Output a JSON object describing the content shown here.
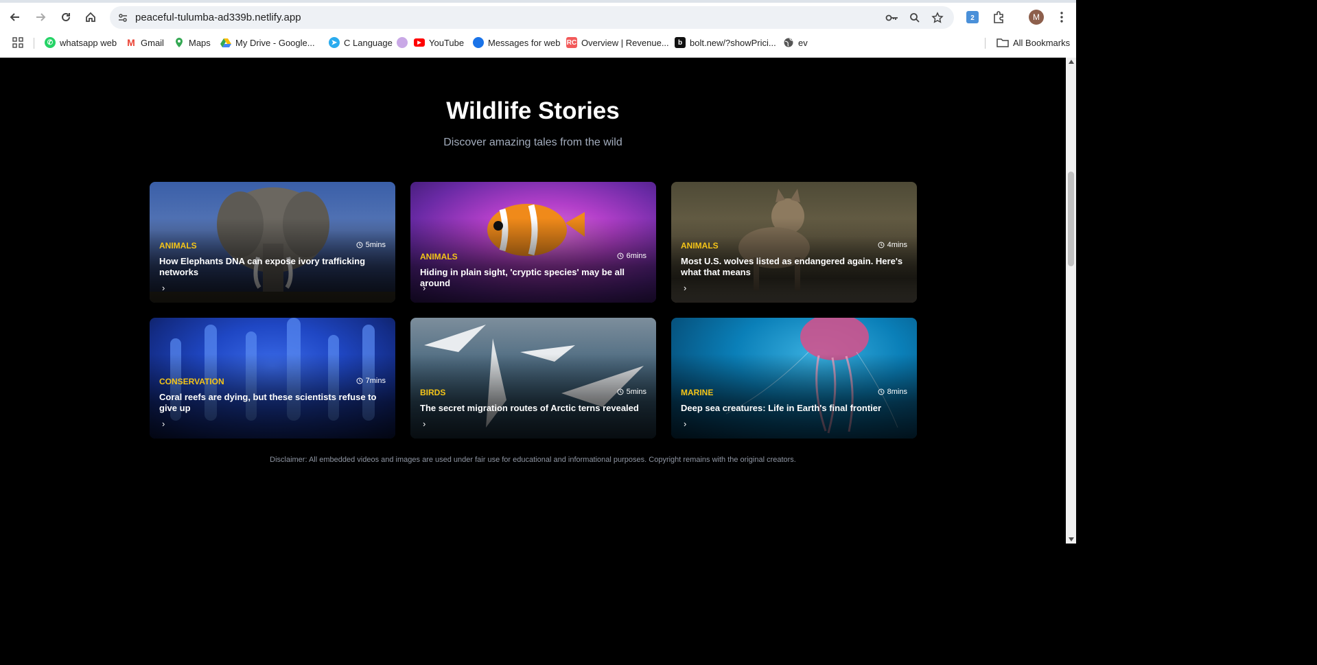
{
  "browser": {
    "url": "peaceful-tulumba-ad339b.netlify.app",
    "avatar_letter": "M",
    "bookmarks": [
      {
        "label": "whatsapp web",
        "icon": "whatsapp-icon",
        "color": "#25d366"
      },
      {
        "label": "Gmail",
        "icon": "gmail-icon",
        "color": "#ea4335"
      },
      {
        "label": "Maps",
        "icon": "maps-icon",
        "color": "#34a853"
      },
      {
        "label": "My Drive - Google...",
        "icon": "drive-icon",
        "color": "#fbbc04"
      },
      {
        "label": "C Language",
        "icon": "telegram-icon",
        "color": "#2aabee"
      },
      {
        "label": "YouTube",
        "icon": "youtube-icon",
        "color": "#ff0000"
      },
      {
        "label": "Messages for web",
        "icon": "messages-icon",
        "color": "#1a73e8"
      },
      {
        "label": "Overview | Revenue...",
        "icon": "revenuecat-icon",
        "color": "#f25a5a"
      },
      {
        "label": "bolt.new/?showPrici...",
        "icon": "bolt-icon",
        "color": "#111111"
      },
      {
        "label": "ev",
        "icon": "globe-icon",
        "color": "#555555"
      }
    ],
    "all_bookmarks_label": "All Bookmarks"
  },
  "section": {
    "title": "Wildlife Stories",
    "subtitle": "Discover amazing tales from the wild"
  },
  "cards": [
    {
      "category": "ANIMALS",
      "time": "5mins",
      "title": "How Elephants DNA can expose ivory trafficking networks",
      "image": "elephant",
      "accent": "#3a5fa8"
    },
    {
      "category": "ANIMALS",
      "time": "6mins",
      "title": "Hiding in plain sight, 'cryptic species' may be all around",
      "image": "clownfish",
      "accent": "#b23fc9"
    },
    {
      "category": "ANIMALS",
      "time": "4mins",
      "title": "Most U.S. wolves listed as endangered again. Here's what that means",
      "image": "wolf",
      "accent": "#5f5840"
    },
    {
      "category": "CONSERVATION",
      "time": "7mins",
      "title": "Coral reefs are dying, but these scientists refuse to give up",
      "image": "coral",
      "accent": "#1f47c4"
    },
    {
      "category": "BIRDS",
      "time": "5mins",
      "title": "The secret migration routes of Arctic terns revealed",
      "image": "terns",
      "accent": "#4c6a80"
    },
    {
      "category": "MARINE",
      "time": "8mins",
      "title": "Deep sea creatures: Life in Earth's final frontier",
      "image": "jellyfish",
      "accent": "#0a7fb8"
    }
  ],
  "disclaimer": "Disclaimer: All embedded videos and images are used under fair use for educational and informational purposes. Copyright remains with the original creators."
}
